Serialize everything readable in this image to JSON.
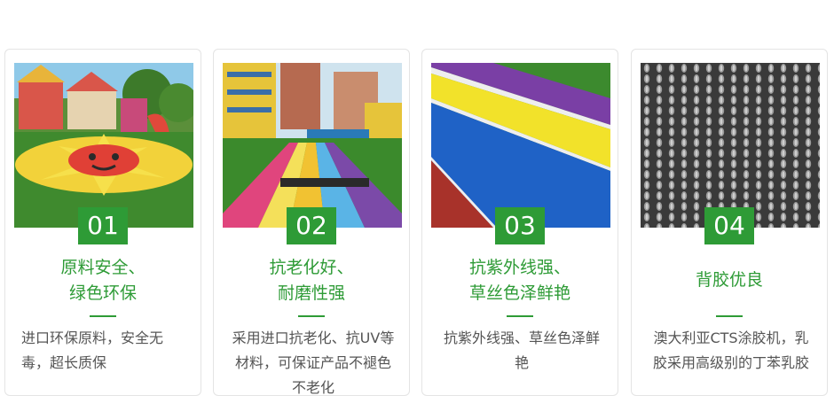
{
  "cards": [
    {
      "number": "01",
      "title_line1": "原料安全、",
      "title_line2": "绿色环保",
      "desc": "进口环保原料，安全无毒，超长质保"
    },
    {
      "number": "02",
      "title_line1": "抗老化好、",
      "title_line2": "耐磨性强",
      "desc": "采用进口抗老化、抗UV等材料，可保证产品不褪色不老化"
    },
    {
      "number": "03",
      "title_line1": "抗紫外线强、",
      "title_line2": "草丝色泽鲜艳",
      "desc": "抗紫外线强、草丝色泽鲜艳"
    },
    {
      "number": "04",
      "title_line1": "背胶优良",
      "title_line2": "",
      "desc": "澳大利亚CTS涂胶机，乳胶采用高级别的丁苯乳胶"
    }
  ],
  "colors": {
    "accent_green": "#2e9b36",
    "card_border": "#e4e4e4",
    "body_text": "#555555"
  },
  "images": [
    {
      "icon": "playground-turf-image"
    },
    {
      "icon": "rainbow-running-track-image"
    },
    {
      "icon": "colored-turf-stripes-image"
    },
    {
      "icon": "turf-backing-closeup-image"
    }
  ]
}
